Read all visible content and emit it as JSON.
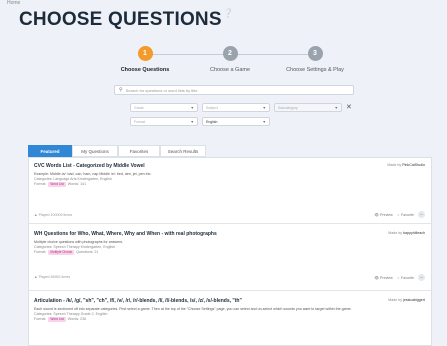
{
  "breadcrumb": "Home",
  "page": {
    "title": "CHOOSE QUESTIONS",
    "help_icon": "question-circle-icon"
  },
  "steps": [
    {
      "number": "1",
      "label": "Choose Questions"
    },
    {
      "number": "2",
      "label": "Choose a Game"
    },
    {
      "number": "3",
      "label": "Choose Settings & Play"
    }
  ],
  "filters": {
    "search_placeholder": "Search for questions or word lists by title",
    "grade": "Grade",
    "subject": "Subject",
    "subcategory": "Subcategory",
    "format": "Format",
    "language": "English"
  },
  "tabs": [
    "Featured",
    "My Questions",
    "Favorites",
    "Search Results"
  ],
  "cards": [
    {
      "title": "CVC Words List - Categorized by Middle Vowel",
      "made_by_label": "Made by",
      "author": "PinkCatStudio",
      "description": "Example: Middle /a/: bad, can, ham, nap Middle /e/: bed, den, jet, pen etc.",
      "categories": "Categories: Language Arts Kindergarten, English",
      "format_label": "Format:",
      "format_badge": "Word List",
      "count": "Words: 141",
      "played": "Played 100009 times",
      "preview": "Preview",
      "favorite": "Favorite",
      "more": "···"
    },
    {
      "title": "WH Questions for Who, What, Where, Why and When - with real photographs",
      "made_by_label": "Made by",
      "author": "happyhilleach",
      "description": "Multiple choice questions with photographs for answers.",
      "categories": "Categories: Speech Therapy Kindergarten, English",
      "format_label": "Format:",
      "format_badge": "Multiple Choice",
      "count": "Questions: 21",
      "played": "Played 46952 times",
      "preview": "Preview",
      "favorite": "Favorite",
      "more": "···"
    },
    {
      "title": "Articulation - /k/, /g/, \"sh\", \"ch\", /f/, /v/, /r/, /r/-blends, /l/, /l/-blends, /s/, /z/, /s/-blends, \"th\"",
      "made_by_label": "Made by",
      "author": "jessicabiggert",
      "description": "Each sound is sectioned off into separate categories. First select a game. Then at the top of the \"Choose Settings\" page, you can select and un-select which sounds you want to target within the game.",
      "categories": "Categories: Speech Therapy Grade 2, English",
      "format_label": "Format:",
      "format_badge": "Word List",
      "count": "Words: 236"
    }
  ]
}
